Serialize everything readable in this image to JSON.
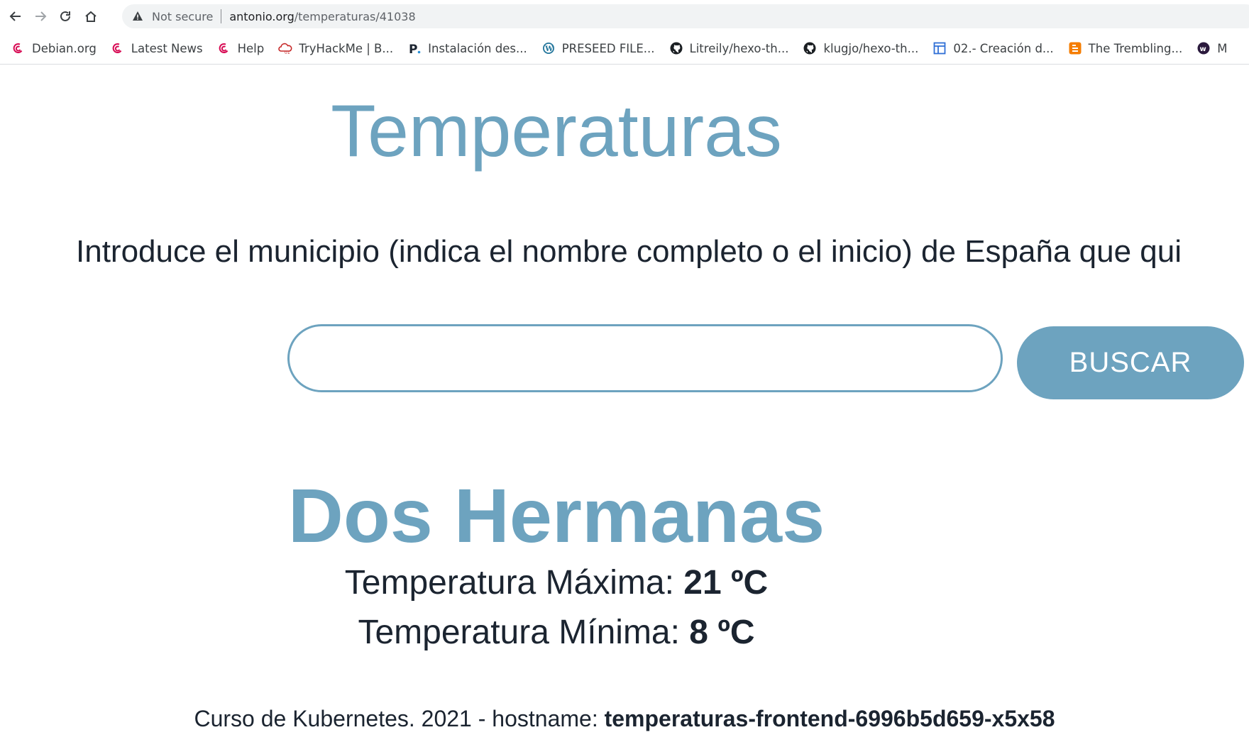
{
  "browser": {
    "security_label": "Not secure",
    "url_host": "antonio.org",
    "url_path": "/temperaturas/41038",
    "bookmarks": [
      {
        "label": "Debian.org",
        "icon": "debian-icon"
      },
      {
        "label": "Latest News",
        "icon": "debian-icon"
      },
      {
        "label": "Help",
        "icon": "debian-icon"
      },
      {
        "label": "TryHackMe | B...",
        "icon": "tryhackme-icon"
      },
      {
        "label": "Instalación des...",
        "icon": "p-logo-icon"
      },
      {
        "label": "PRESEED FILE...",
        "icon": "wordpress-icon"
      },
      {
        "label": "Litreily/hexo-th...",
        "icon": "github-icon"
      },
      {
        "label": "klugjo/hexo-th...",
        "icon": "github-icon"
      },
      {
        "label": "02.- Creación d...",
        "icon": "document-icon"
      },
      {
        "label": "The Trembling...",
        "icon": "blogger-icon"
      },
      {
        "label": "M",
        "icon": "w-circle-icon"
      }
    ]
  },
  "page": {
    "title": "Temperaturas",
    "intro": "Introduce el municipio (indica el nombre completo o el inicio) de España que qui",
    "search": {
      "value": "",
      "button_label": "BUSCAR"
    },
    "city": "Dos Hermanas",
    "max": {
      "label": "Temperatura Máxima: ",
      "value": "21 ºC"
    },
    "min": {
      "label": "Temperatura Mínima: ",
      "value": "8 ºC"
    },
    "footer": {
      "text": "Curso de Kubernetes. 2021 - hostname: ",
      "hostname": "temperaturas-frontend-6996b5d659-x5x58"
    }
  },
  "colors": {
    "accent": "#6da3bf",
    "text": "#1b2430",
    "debian": "#d70a53",
    "blogger": "#f57d00"
  }
}
